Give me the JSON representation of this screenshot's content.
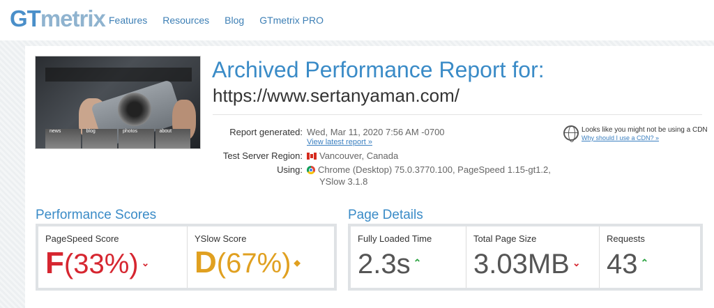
{
  "logo": {
    "part1": "GT",
    "part2": "metrix"
  },
  "nav": [
    "Features",
    "Resources",
    "Blog",
    "GTmetrix PRO"
  ],
  "screenshot": {
    "tiles": [
      "news",
      "blog",
      "photos",
      "about"
    ]
  },
  "report": {
    "title": "Archived Performance Report for:",
    "url": "https://www.sertanyaman.com/",
    "generated_label": "Report generated:",
    "generated_value": "Wed, Mar 11, 2020 7:56 AM -0700",
    "latest_link": "View latest report »",
    "region_label": "Test Server Region:",
    "region_value": "Vancouver, Canada",
    "using_label": "Using:",
    "using_value_line1": "Chrome (Desktop) 75.0.3770.100, PageSpeed 1.15-gt1.2,",
    "using_value_line2": "YSlow 3.1.8"
  },
  "cdn": {
    "message": "Looks like you might not be using a CDN",
    "link": "Why should I use a CDN? »"
  },
  "performance": {
    "title": "Performance Scores",
    "pagespeed": {
      "label": "PageSpeed Score",
      "grade": "F",
      "percent": "(33%)",
      "trend": "down"
    },
    "yslow": {
      "label": "YSlow Score",
      "grade": "D",
      "percent": "(67%)",
      "trend": "neutral"
    }
  },
  "details": {
    "title": "Page Details",
    "loaded": {
      "label": "Fully Loaded Time",
      "value": "2.3s",
      "trend": "up"
    },
    "size": {
      "label": "Total Page Size",
      "value": "3.03MB",
      "trend": "down"
    },
    "requests": {
      "label": "Requests",
      "value": "43",
      "trend": "up"
    }
  },
  "colors": {
    "accent": "#3a8bc7",
    "grade_f": "#d62630",
    "grade_d": "#e0a020",
    "trend_up": "#2aa340"
  }
}
